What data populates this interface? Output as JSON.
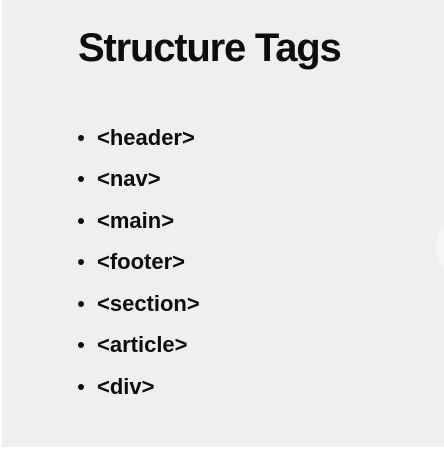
{
  "slide": {
    "title": "Structure Tags",
    "bullets": [
      "<header>",
      "<nav>",
      "<main>",
      "<footer>",
      "<section>",
      "<article>",
      "<div>"
    ]
  },
  "colors": {
    "background": "#efefef",
    "text": "#0d0d0d"
  }
}
